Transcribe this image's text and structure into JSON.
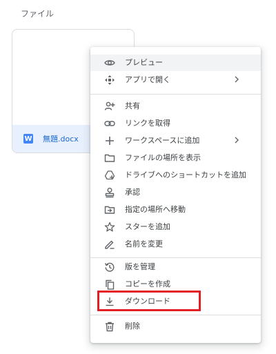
{
  "section_title": "ファイル",
  "file": {
    "icon_letter": "W",
    "name": "無題.docx"
  },
  "menu": {
    "preview": "プレビュー",
    "open_with": "アプリで開く",
    "share": "共有",
    "get_link": "リンクを取得",
    "add_to_workspace": "ワークスペースに追加",
    "show_location": "ファイルの場所を表示",
    "add_shortcut": "ドライブへのショートカットを追加",
    "approve": "承認",
    "move_to": "指定の場所へ移動",
    "add_star": "スターを追加",
    "rename": "名前を変更",
    "manage_versions": "版を管理",
    "make_copy": "コピーを作成",
    "download": "ダウンロード",
    "delete": "削除"
  },
  "colors": {
    "highlight": "#f1f3f4",
    "outline": "#e31e24",
    "word_icon": "#4285f4",
    "selection": "#e8f0fe"
  }
}
